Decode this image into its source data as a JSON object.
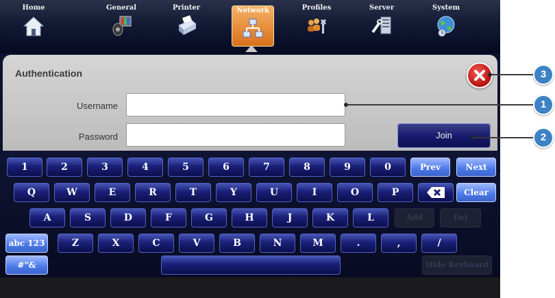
{
  "nav": {
    "items": [
      {
        "label": "Home",
        "icon": "house-icon"
      },
      {
        "label": "General",
        "icon": "speaker-display-icon"
      },
      {
        "label": "Printer",
        "icon": "printer-icon"
      },
      {
        "label": "Network",
        "icon": "network-icon",
        "active": true
      },
      {
        "label": "Profiles",
        "icon": "users-tools-icon"
      },
      {
        "label": "Server",
        "icon": "server-icon"
      },
      {
        "label": "System",
        "icon": "globe-icon"
      }
    ]
  },
  "auth": {
    "title": "Authentication",
    "username_label": "Username",
    "username_value": "",
    "password_label": "Password",
    "password_value": "",
    "join_label": "Join"
  },
  "keyboard": {
    "row1": [
      "1",
      "2",
      "3",
      "4",
      "5",
      "6",
      "7",
      "8",
      "9",
      "0"
    ],
    "prev_label": "Prev",
    "next_label": "Next",
    "row2": [
      "Q",
      "W",
      "E",
      "R",
      "T",
      "Y",
      "U",
      "I",
      "O",
      "P"
    ],
    "clear_label": "Clear",
    "row3": [
      "A",
      "S",
      "D",
      "F",
      "G",
      "H",
      "J",
      "K",
      "L"
    ],
    "add_label": "Add",
    "del_label": "Del",
    "abc_label": "abc 123",
    "row4": [
      "Z",
      "X",
      "C",
      "V",
      "B",
      "N",
      "M",
      ".",
      ",",
      "/"
    ],
    "symbols_label": "#\"&",
    "hide_label": "Hide Keyboard"
  },
  "callouts": [
    "3",
    "1",
    "2"
  ],
  "colors": {
    "accent_active": "#e8892c",
    "key_blue": "#1a2078",
    "callout_blue": "#3d82c4",
    "close_red": "#c81c16"
  }
}
